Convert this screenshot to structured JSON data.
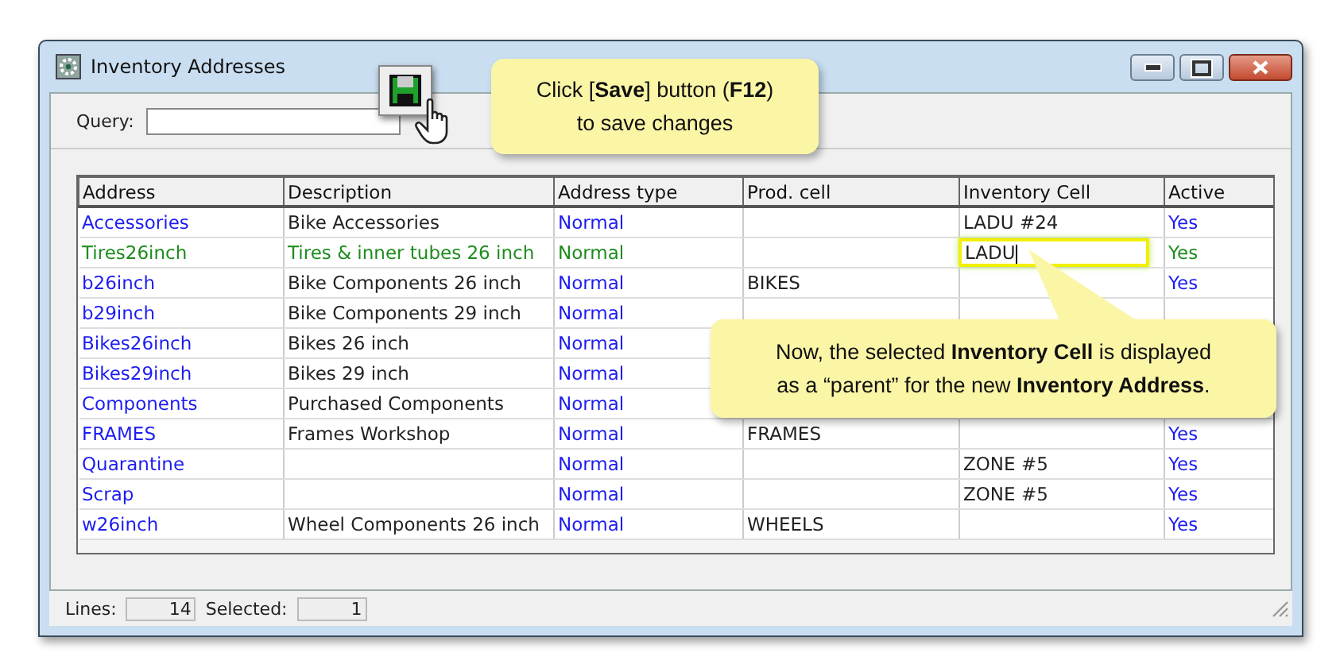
{
  "window": {
    "title": "Inventory Addresses"
  },
  "query": {
    "label": "Query:"
  },
  "save_callout": {
    "lines": [
      "Click [**Save**] button (**F12**)",
      "to save changes"
    ]
  },
  "table": {
    "columns": [
      {
        "label": "Address",
        "kind": "link"
      },
      {
        "label": "Description",
        "kind": "text"
      },
      {
        "label": "Address type",
        "kind": "link"
      },
      {
        "label": "Prod. cell",
        "kind": "code"
      },
      {
        "label": "Inventory Cell",
        "kind": "code"
      },
      {
        "label": "Active",
        "kind": "link"
      }
    ],
    "rows": [
      {
        "cells": [
          "Accessories",
          "Bike Accessories",
          "Normal",
          "",
          "LADU #24",
          "Yes"
        ],
        "selected": false,
        "editing": false
      },
      {
        "cells": [
          "Tires26inch",
          "Tires & inner tubes 26 inch",
          "Normal",
          "",
          "LADU",
          "Yes"
        ],
        "selected": true,
        "editing": true
      },
      {
        "cells": [
          "b26inch",
          "Bike Components 26 inch",
          "Normal",
          "BIKES",
          "",
          "Yes"
        ],
        "selected": false,
        "editing": false
      },
      {
        "cells": [
          "b29inch",
          "Bike Components 29 inch",
          "Normal",
          "",
          "",
          ""
        ],
        "selected": false,
        "editing": false
      },
      {
        "cells": [
          "Bikes26inch",
          "Bikes 26 inch",
          "Normal",
          "",
          "",
          ""
        ],
        "selected": false,
        "editing": false
      },
      {
        "cells": [
          "Bikes29inch",
          "Bikes 29 inch",
          "Normal",
          "",
          "",
          ""
        ],
        "selected": false,
        "editing": false
      },
      {
        "cells": [
          "Components",
          "Purchased Components",
          "Normal",
          "",
          "",
          ""
        ],
        "selected": false,
        "editing": false
      },
      {
        "cells": [
          "FRAMES",
          "Frames Workshop",
          "Normal",
          "FRAMES",
          "",
          "Yes"
        ],
        "selected": false,
        "editing": false
      },
      {
        "cells": [
          "Quarantine",
          "",
          "Normal",
          "",
          "ZONE #5",
          "Yes"
        ],
        "selected": false,
        "editing": false
      },
      {
        "cells": [
          "Scrap",
          "",
          "Normal",
          "",
          "ZONE #5",
          "Yes"
        ],
        "selected": false,
        "editing": false
      },
      {
        "cells": [
          "w26inch",
          "Wheel Components 26 inch",
          "Normal",
          "WHEELS",
          "",
          "Yes"
        ],
        "selected": false,
        "editing": false
      }
    ]
  },
  "parent_callout": {
    "lines": [
      "Now, the selected **Inventory Cell** is displayed",
      "as a “parent” for the new **Inventory Address**."
    ]
  },
  "status_bar": {
    "lines_label": "Lines:",
    "lines_value": "14",
    "selected_label": "Selected:",
    "selected_value": "1"
  }
}
